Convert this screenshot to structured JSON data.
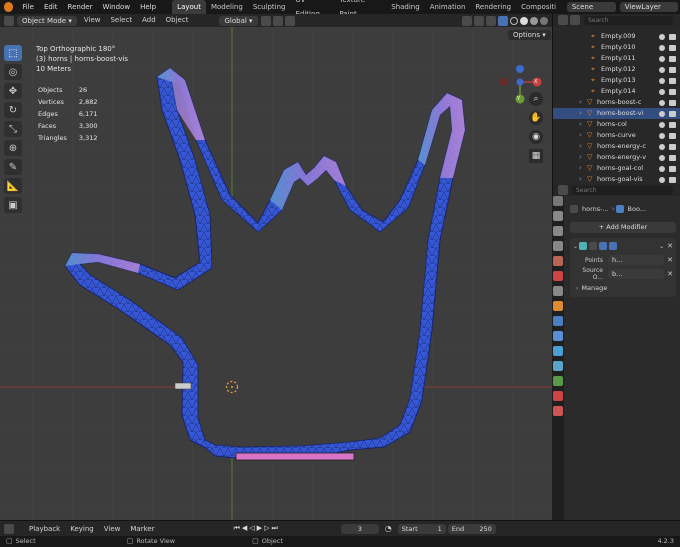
{
  "menubar": {
    "items": [
      "File",
      "Edit",
      "Render",
      "Window",
      "Help"
    ],
    "workspaces": [
      "Layout",
      "Modeling",
      "Sculpting",
      "UV Editing",
      "Texture Paint",
      "Shading",
      "Animation",
      "Rendering",
      "Compositi"
    ],
    "active_workspace": "Layout",
    "scene": "Scene",
    "view_layer": "ViewLayer"
  },
  "viewport_header": {
    "mode": "Object Mode",
    "menus": [
      "View",
      "Select",
      "Add",
      "Object"
    ],
    "transform_orientation": "Global",
    "options_label": "Options"
  },
  "overlay": {
    "view_name": "Top Orthographic 180°",
    "collection": "(3) horns | horns-boost-vis",
    "scale": "10 Meters",
    "stats": [
      {
        "label": "Objects",
        "value": "26"
      },
      {
        "label": "Vertices",
        "value": "2,882"
      },
      {
        "label": "Edges",
        "value": "6,171"
      },
      {
        "label": "Faces",
        "value": "3,300"
      },
      {
        "label": "Triangles",
        "value": "3,312"
      }
    ]
  },
  "gizmo": {
    "x": "X",
    "y": "Y",
    "z": "Z"
  },
  "outliner": {
    "search_placeholder": "Search",
    "items": [
      {
        "name": "Empty.009",
        "type": "empty"
      },
      {
        "name": "Empty.010",
        "type": "empty"
      },
      {
        "name": "Empty.011",
        "type": "empty"
      },
      {
        "name": "Empty.012",
        "type": "empty"
      },
      {
        "name": "Empty.013",
        "type": "empty"
      },
      {
        "name": "Empty.014",
        "type": "empty"
      },
      {
        "name": "horns-boost-c",
        "type": "mesh"
      },
      {
        "name": "horns-boost-vi",
        "type": "mesh",
        "selected": true
      },
      {
        "name": "horns-col",
        "type": "mesh"
      },
      {
        "name": "horns-curve",
        "type": "curve"
      },
      {
        "name": "horns-energy-c",
        "type": "mesh"
      },
      {
        "name": "horns-energy-v",
        "type": "mesh"
      },
      {
        "name": "horns-goal-col",
        "type": "mesh"
      },
      {
        "name": "horns-goal-vis",
        "type": "mesh"
      }
    ]
  },
  "properties": {
    "search_placeholder": "Search",
    "object_name": "horns-...",
    "modifier_name": "Boo...",
    "add_modifier": "Add Modifier",
    "fields": [
      {
        "label": "Points",
        "value": "h..."
      },
      {
        "label": "Source O...",
        "value": "b..."
      }
    ],
    "manage": "Manage"
  },
  "timeline": {
    "menus": [
      "Playback",
      "Keying",
      "View",
      "Marker"
    ],
    "current_frame": "3",
    "start_label": "Start",
    "start": "1",
    "end_label": "End",
    "end": "250"
  },
  "statusbar": {
    "select": "Select",
    "rotate": "Rotate View",
    "object": "Object",
    "version": "4.2.3"
  },
  "colors": {
    "accent": "#4772b3",
    "mesh_blue": "#3355dd",
    "mesh_purple": "#b07ad0",
    "mesh_teal": "#55aacc",
    "axis_red": "#b33c3c",
    "axis_green": "#6b9b33"
  }
}
